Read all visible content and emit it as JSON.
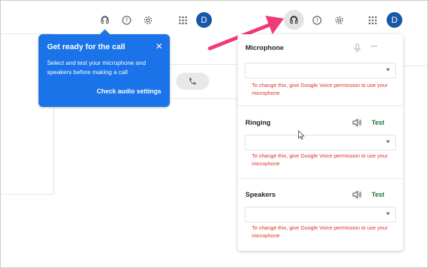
{
  "header": {
    "avatar_letter": "D",
    "icons": [
      "headset-icon",
      "help-icon",
      "settings-icon",
      "apps-grid-icon"
    ]
  },
  "tooltip": {
    "title": "Get ready for the call",
    "close_glyph": "✕",
    "body": "Select and test your microphone and speakers before making a call",
    "link": "Check audio settings"
  },
  "audio_panel": {
    "microphone": {
      "title": "Microphone",
      "more_glyph": "···",
      "error": "To change this, give Google Voice permission to use your microphone"
    },
    "ringing": {
      "title": "Ringing",
      "test_label": "Test",
      "error": "To change this, give Google Voice permission to use your microphone"
    },
    "speakers": {
      "title": "Speakers",
      "test_label": "Test",
      "error": "To change this, give Google Voice permission to use your microphone"
    }
  },
  "colors": {
    "accent_blue": "#1a73e8",
    "arrow": "#f0387a",
    "error_red": "#d93025",
    "test_green": "#137333",
    "avatar_bg": "#1558a8"
  }
}
